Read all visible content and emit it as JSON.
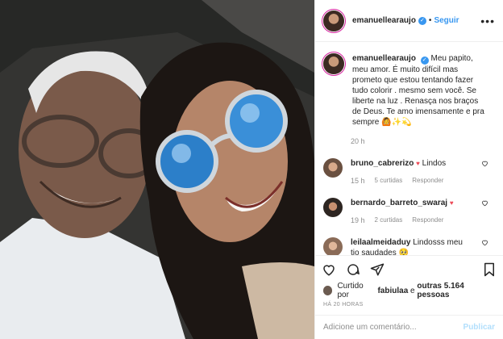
{
  "header": {
    "username": "emanuellearaujo",
    "follow_label": "Seguir",
    "separator": "•"
  },
  "caption": {
    "username": "emanuellearaujo",
    "text": "Meu papito, meu amor. É muito difícil mas prometo que estou tentando fazer tudo colorir . mesmo sem você. Se liberte na luz . Renasça nos braços de Deus. Te amo imensamente e pra sempre 🙆✨💫",
    "time": "20 h"
  },
  "comments": [
    {
      "username": "bruno_cabrerizo",
      "text": "Lindos",
      "emoji": "♥",
      "time": "15 h",
      "likes": "5 curtidas",
      "reply": "Responder"
    },
    {
      "username": "bernardo_barreto_swaraj",
      "text": "",
      "emoji": "♥",
      "time": "19 h",
      "likes": "2 curtidas",
      "reply": "Responder"
    },
    {
      "username": "leilaalmeidaduy",
      "text": "Lindosss meu tio saudades 🥺",
      "emoji": "",
      "time": "",
      "likes": "",
      "reply": ""
    }
  ],
  "likes": {
    "prefix": "Curtido por",
    "user": "fabiulaa",
    "middle": "e",
    "others": "outras 5.164 pessoas"
  },
  "timestamp": "HÁ 20 HORAS",
  "comment_input": {
    "placeholder": "Adicione um comentário...",
    "publish_label": "Publicar"
  },
  "colors": {
    "accent": "#3897f0",
    "like": "#ed4956",
    "muted": "#8e8e8e"
  },
  "icons": [
    "heart-icon",
    "comment-icon",
    "share-icon",
    "bookmark-icon",
    "more-icon",
    "verified-icon"
  ]
}
